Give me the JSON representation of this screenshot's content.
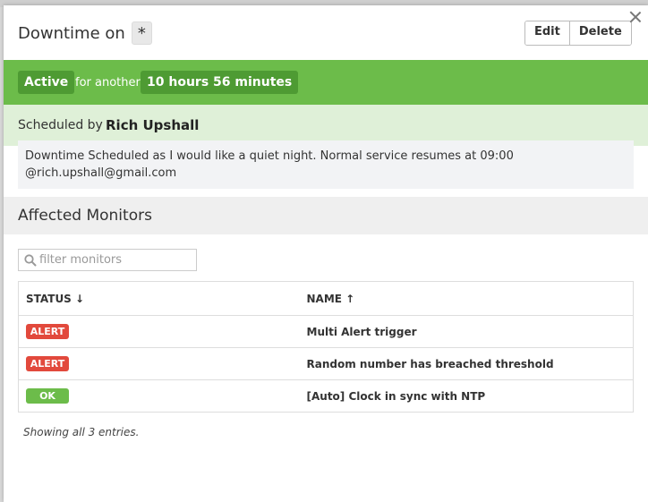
{
  "header": {
    "title": "Downtime on",
    "scope": "*",
    "edit_label": "Edit",
    "delete_label": "Delete",
    "close_icon": "close-icon"
  },
  "status": {
    "state": "Active",
    "connector": "for another",
    "remaining": "10 hours 56 minutes",
    "bar_color": "#6cbc4a",
    "pill_color": "#4e9b33"
  },
  "schedule": {
    "label": "Scheduled by",
    "name": "Rich Upshall",
    "message_line1": "Downtime Scheduled as I would like a quiet night. Normal service resumes at 09:00",
    "message_line2": "@rich.upshall@gmail.com"
  },
  "monitors": {
    "title": "Affected Monitors",
    "filter_placeholder": "filter monitors",
    "columns": {
      "status": "STATUS ↓",
      "name": "NAME ↑"
    },
    "rows": [
      {
        "status": "ALERT",
        "status_color": "#e2493c",
        "name": "Multi Alert trigger"
      },
      {
        "status": "ALERT",
        "status_color": "#e2493c",
        "name": "Random number has breached threshold"
      },
      {
        "status": "OK",
        "status_color": "#6cbc4a",
        "name": "[Auto] Clock in sync with NTP"
      }
    ],
    "footer": "Showing all 3 entries."
  }
}
